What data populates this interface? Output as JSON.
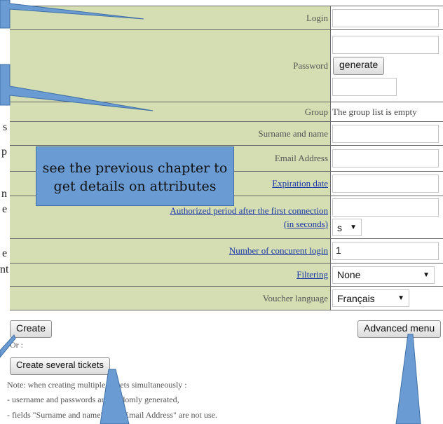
{
  "form": {
    "login_label": "Login",
    "password_label": "Password",
    "generate_label": "generate",
    "group_label": "Group",
    "group_value": "The group list is empty",
    "name_label": "Surname and name",
    "email_label": "Email Address",
    "expiration_label": "Expiration date",
    "period_label_1": "Authorized period after the first connection",
    "period_label_2": "(in seconds)",
    "period_unit": "s",
    "concurrent_label": "Number of concurent login",
    "concurrent_value": "1",
    "filtering_label": "Filtering",
    "filtering_value": "None",
    "language_label": "Voucher language",
    "language_value": "Français"
  },
  "actions": {
    "create_label": "Create",
    "advanced_label": "Advanced menu",
    "or_text": "Or :",
    "several_label": "Create several tickets",
    "note_line1": "Note: when creating multiple tickets simultaneously :",
    "note_line2": "- username and passwords are randomly generated,",
    "note_line3": "- fields \"Surname and name\" and \"Email Address\" are not use."
  },
  "callout": {
    "text_line1": "see the previous chapter to",
    "text_line2": "get details on attributes"
  },
  "side_text": [
    "s",
    "p",
    "n",
    "e",
    "e",
    "nt"
  ],
  "colors": {
    "label_bg": "#d4deb2",
    "callout_bg": "#6a9cd3",
    "link": "#1a36a8"
  }
}
